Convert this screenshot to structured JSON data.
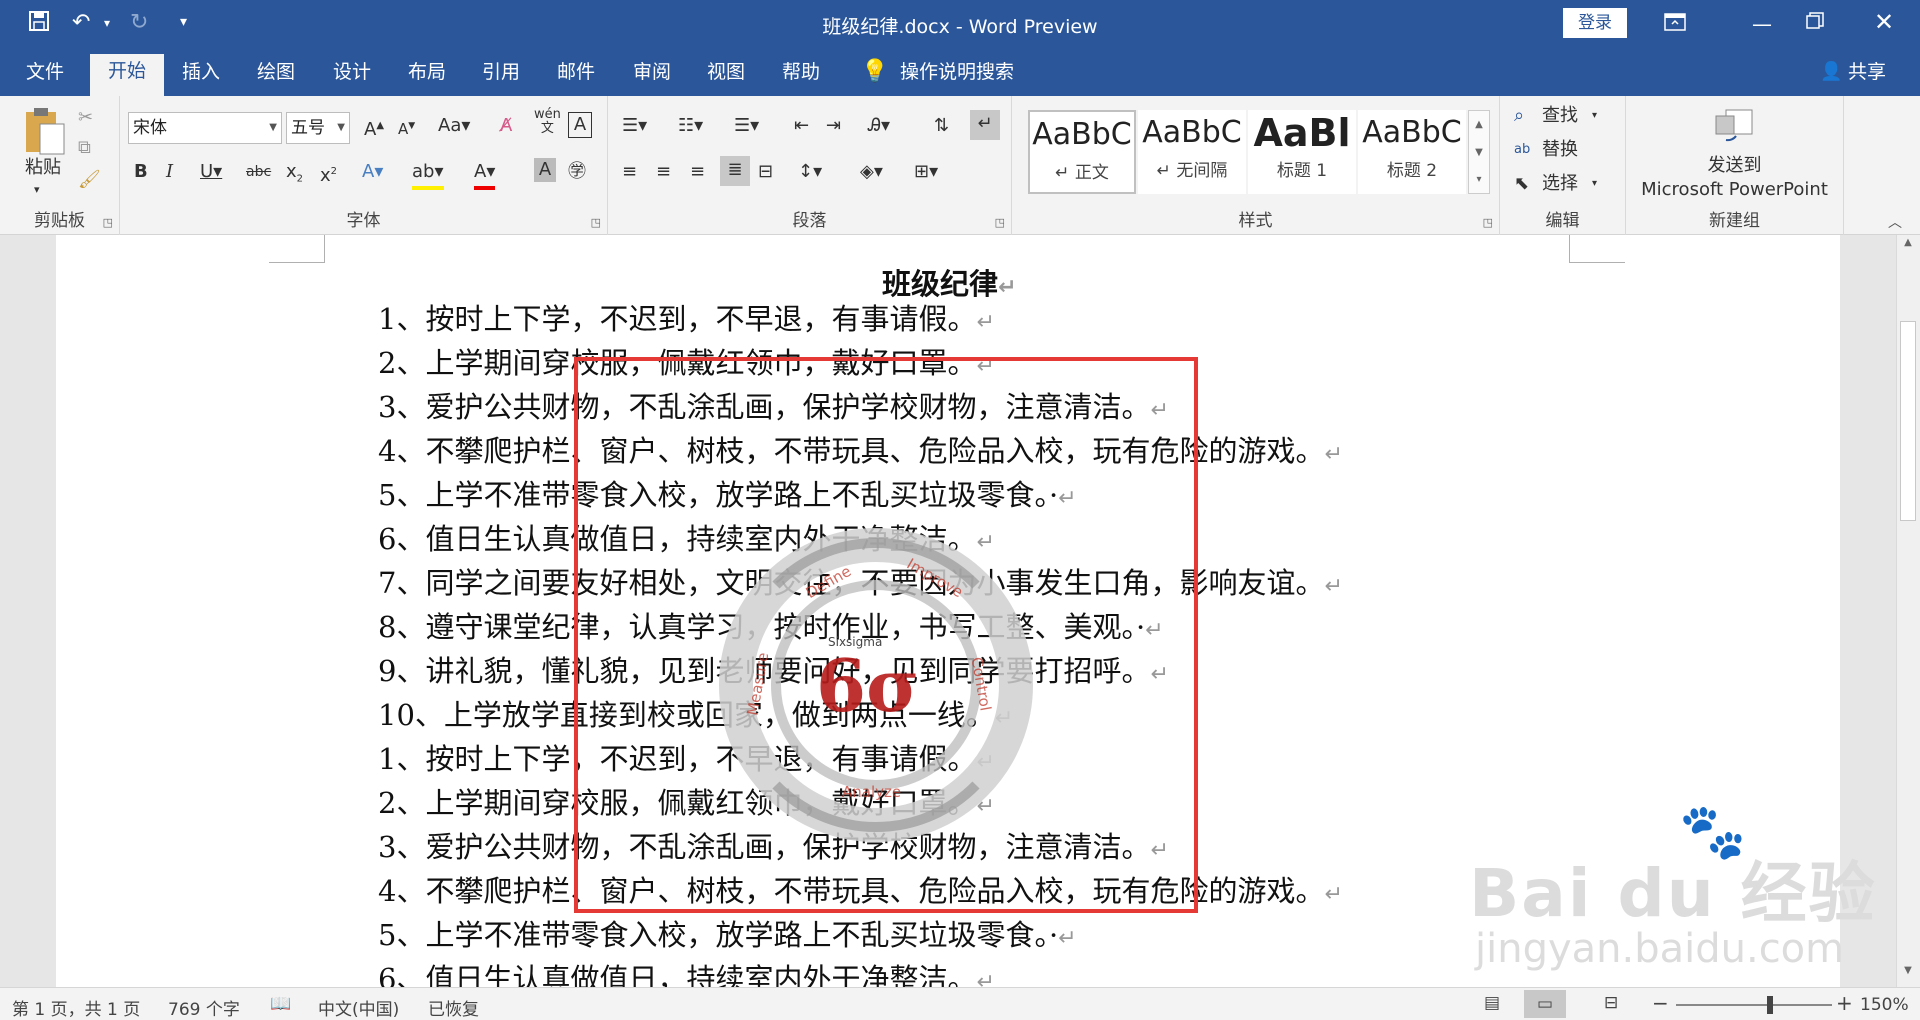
{
  "titlebar": {
    "title": "班级纪律.docx  -  Word Preview",
    "login_label": "登录"
  },
  "tabs": [
    "文件",
    "开始",
    "插入",
    "绘图",
    "设计",
    "布局",
    "引用",
    "邮件",
    "审阅",
    "视图",
    "帮助"
  ],
  "search_tab": "操作说明搜索",
  "share_label": "共享",
  "ribbon": {
    "clipboard": {
      "paste": "粘贴",
      "group": "剪贴板"
    },
    "font": {
      "name": "宋体",
      "size": "五号",
      "group": "字体"
    },
    "paragraph": {
      "group": "段落"
    },
    "styles": {
      "items": [
        {
          "sample": "AaBbC",
          "name": "↵ 正文"
        },
        {
          "sample": "AaBbC",
          "name": "↵ 无间隔"
        },
        {
          "sample": "AaBl",
          "name": "标题 1"
        },
        {
          "sample": "AaBbC",
          "name": "标题 2"
        }
      ],
      "group": "样式"
    },
    "editing": {
      "find": "查找",
      "replace": "替换",
      "select": "选择",
      "group": "编辑"
    },
    "newgroup": {
      "send1": "发送到",
      "send2": "Microsoft PowerPoint",
      "group": "新建组"
    }
  },
  "document": {
    "heading": "班级纪律",
    "lines": [
      "1、按时上下学，不迟到，不早退，有事请假。",
      "2、上学期间穿校服，佩戴红领巾，戴好口罩。",
      "3、爱护公共财物，不乱涂乱画，保护学校财物，注意清洁。",
      "4、不攀爬护栏、窗户、树枝，不带玩具、危险品入校，玩有危险的游戏。",
      "5、上学不准带零食入校，放学路上不乱买垃圾零食。·",
      "6、值日生认真做值日，持续室内外干净整洁。",
      "7、同学之间要友好相处，文明交往，不要因为小事发生口角，影响友谊。",
      "8、遵守课堂纪律，认真学习，按时作业，书写工整、美观。·",
      "9、讲礼貌，懂礼貌，见到老师要问好，见到同学要打招呼。",
      "10、上学放学直接到校或回家，做到两点一线。",
      "1、按时上下学，不迟到，不早退，有事请假。",
      "2、上学期间穿校服，佩戴红领巾，戴好口罩。",
      "3、爱护公共财物，不乱涂乱画，保护学校财物，注意清洁。",
      "4、不攀爬护栏、窗户、树枝，不带玩具、危险品入校，玩有危险的游戏。",
      "5、上学不准带零食入校，放学路上不乱买垃圾零食。·",
      "6、值日生认真做值日，持续室内外干净整洁。"
    ],
    "paragraph_mark": "↵",
    "watermark_texts": [
      "Define",
      "Improve",
      "Analyze",
      "Measure",
      "Control",
      "Sixsigma",
      "6σ"
    ],
    "baidu_logo": "Bai du 经验",
    "baidu_url": "jingyan.baidu.com",
    "highlight_color": "#e53935"
  },
  "statusbar": {
    "page": "第 1 页，共 1 页",
    "words": "769 个字",
    "lang": "中文(中国)",
    "restore": "已恢复",
    "zoom": "150%"
  }
}
